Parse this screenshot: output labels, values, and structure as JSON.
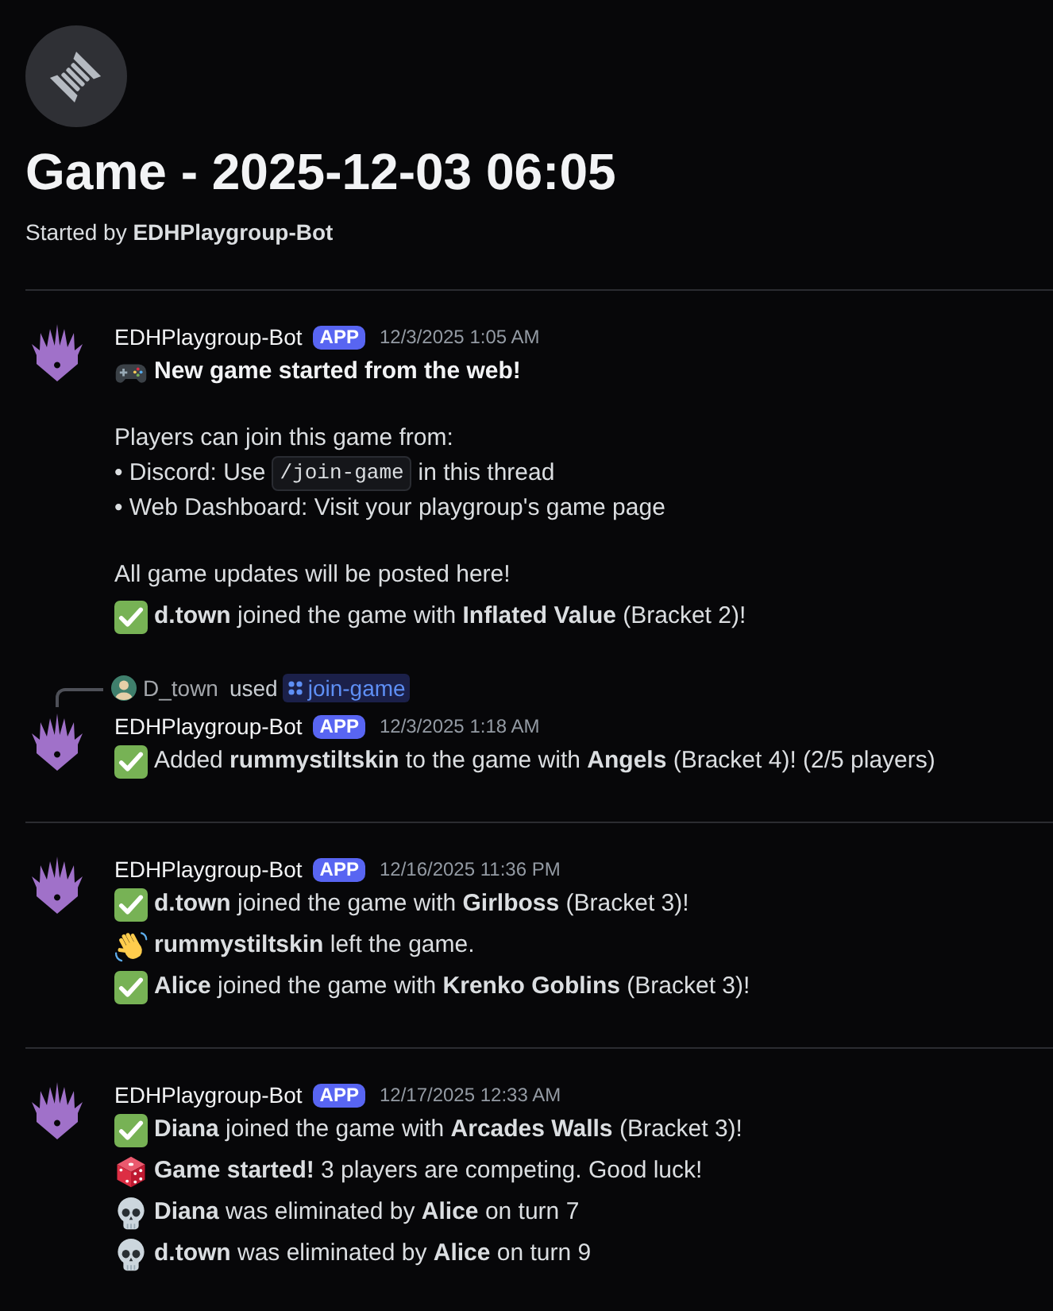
{
  "thread": {
    "title": "Game - 2025-12-03 06:05",
    "started_by": "Started by **EDHPlaygroup-Bot**"
  },
  "groups": [
    {
      "separator": true,
      "author": "EDHPlaygroup-Bot",
      "badge": "APP",
      "timestamp": "12/3/2025 1:05 AM",
      "messages": [
        {
          "paragraphs": [
            [
              {
                "kind": "controller",
                "bold": true,
                "text": "New game started from the web!"
              }
            ],
            [
              {
                "kind": "plain",
                "bold": false,
                "text": "Players can join this game from:"
              },
              {
                "kind": "plain",
                "bold": false,
                "parts": [
                  {
                    "kind": "text",
                    "text": "• Discord: Use"
                  },
                  {
                    "kind": "code",
                    "text": "/join-game"
                  },
                  {
                    "kind": "text",
                    "text": "in this thread"
                  }
                ]
              },
              {
                "kind": "plain",
                "bold": false,
                "text": "• Web Dashboard: Visit your playgroup's game page"
              }
            ],
            [
              {
                "kind": "plain",
                "bold": false,
                "text": "All game updates will be posted here!"
              }
            ]
          ]
        },
        {
          "paragraphs": [
            [
              {
                "kind": "check",
                "bold": false,
                "text": "**d.town** joined the game with **Inflated Value** (Bracket 2)!"
              }
            ]
          ]
        }
      ]
    },
    {
      "separator": false,
      "reply": {
        "user": "D_town",
        "verb": "used",
        "command": "join-game"
      },
      "author": "EDHPlaygroup-Bot",
      "badge": "APP",
      "timestamp": "12/3/2025 1:18 AM",
      "messages": [
        {
          "paragraphs": [
            [
              {
                "kind": "check",
                "bold": false,
                "text": "Added **rummystiltskin** to the game with **Angels** (Bracket 4)! (2/5 players)"
              }
            ]
          ]
        }
      ]
    },
    {
      "separator": true,
      "author": "EDHPlaygroup-Bot",
      "badge": "APP",
      "timestamp": "12/16/2025 11:36 PM",
      "messages": [
        {
          "paragraphs": [
            [
              {
                "kind": "check",
                "bold": false,
                "text": "**d.town** joined the game with **Girlboss** (Bracket 3)!"
              }
            ]
          ]
        },
        {
          "paragraphs": [
            [
              {
                "kind": "wave",
                "bold": false,
                "text": "**rummystiltskin** left the game."
              }
            ]
          ]
        },
        {
          "paragraphs": [
            [
              {
                "kind": "check",
                "bold": false,
                "text": "**Alice** joined the game with **Krenko Goblins** (Bracket 3)!"
              }
            ]
          ]
        }
      ]
    },
    {
      "separator": true,
      "author": "EDHPlaygroup-Bot",
      "badge": "APP",
      "timestamp": "12/17/2025 12:33 AM",
      "messages": [
        {
          "paragraphs": [
            [
              {
                "kind": "check",
                "bold": false,
                "text": "**Diana** joined the game with **Arcades Walls** (Bracket 3)!"
              }
            ]
          ]
        },
        {
          "paragraphs": [
            [
              {
                "kind": "die",
                "bold": false,
                "text": "**Game started!** 3 players are competing. Good luck!"
              }
            ]
          ]
        },
        {
          "paragraphs": [
            [
              {
                "kind": "skull",
                "bold": false,
                "text": "**Diana** was eliminated by **Alice** on turn 7"
              }
            ]
          ]
        },
        {
          "paragraphs": [
            [
              {
                "kind": "skull",
                "bold": false,
                "text": "**d.town** was eliminated by **Alice** on turn 9"
              }
            ]
          ]
        }
      ]
    }
  ]
}
